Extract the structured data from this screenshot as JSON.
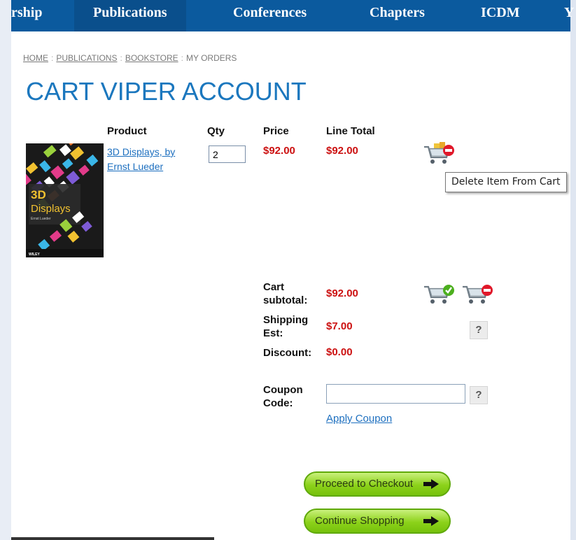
{
  "nav": {
    "items": [
      "rship",
      "Publications",
      "Conferences",
      "Chapters",
      "ICDM",
      "Y"
    ],
    "active_index": 1
  },
  "breadcrumb": {
    "home": "HOME",
    "publications": "PUBLICATIONS",
    "bookstore": "BOOKSTORE",
    "current": "MY ORDERS",
    "separator": ":"
  },
  "page_title": "CART VIPER ACCOUNT",
  "table": {
    "headers": {
      "product": "Product",
      "qty": "Qty",
      "price": "Price",
      "line_total": "Line Total"
    }
  },
  "item": {
    "name": "3D Displays, by Ernst Lueder",
    "qty": "2",
    "price": "$92.00",
    "line_total": "$92.00",
    "cover": {
      "title_3d": "3D",
      "title_word": "Displays",
      "author": "Ernst Lueder",
      "publisher": "WILEY"
    }
  },
  "tooltip": "Delete Item From Cart",
  "totals": {
    "subtotal_label": "Cart subtotal:",
    "subtotal": "$92.00",
    "shipping_label": "Shipping Est:",
    "shipping": "$7.00",
    "discount_label": "Discount:",
    "discount": "$0.00"
  },
  "coupon": {
    "label": "Coupon Code:",
    "value": "",
    "placeholder": "",
    "apply_label": "Apply Coupon"
  },
  "help_glyph": "?",
  "buttons": {
    "checkout": "Proceed to Checkout",
    "continue": "Continue Shopping"
  },
  "colors": {
    "nav_bg": "#0b5a9e",
    "title": "#1b77be",
    "price_red": "#cc1111",
    "link": "#1d6fbf",
    "button_green": "#8cd21a"
  }
}
